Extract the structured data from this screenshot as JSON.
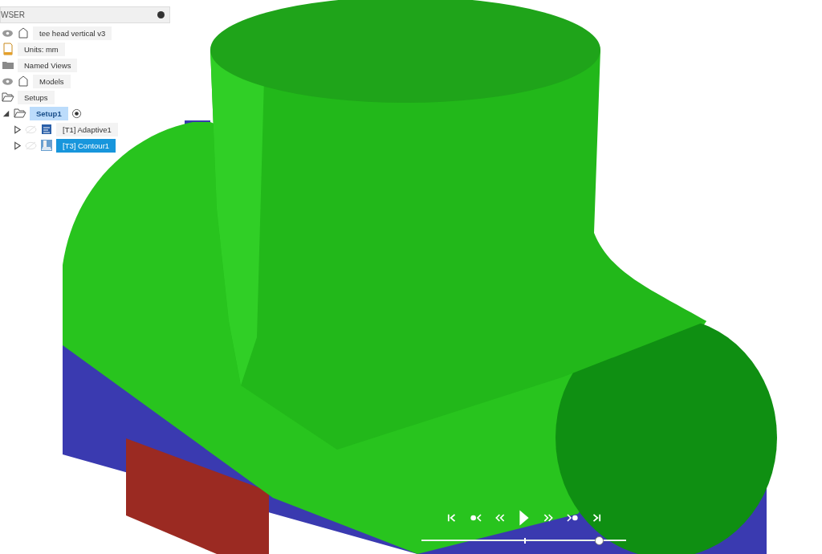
{
  "browser": {
    "title": "WSER",
    "tree": [
      {
        "label": "tee head vertical v3",
        "kind": "component",
        "visible": true
      },
      {
        "label": "Units: mm",
        "kind": "document"
      },
      {
        "label": "Named Views",
        "kind": "folder"
      },
      {
        "label": "Models",
        "kind": "component",
        "visible": true
      },
      {
        "label": "Setups",
        "kind": "folder-open",
        "children": [
          {
            "label": "Setup1",
            "kind": "folder-open",
            "expanded": true,
            "active": true,
            "selected": false,
            "children": [
              {
                "label": "[T1] Adaptive1",
                "kind": "adaptive",
                "expanded": false,
                "visible": false,
                "selected": false
              },
              {
                "label": "[T3] Contour1",
                "kind": "contour",
                "expanded": false,
                "visible": false,
                "selected": true
              }
            ]
          }
        ]
      }
    ]
  },
  "playback": {
    "level": 0.89
  }
}
